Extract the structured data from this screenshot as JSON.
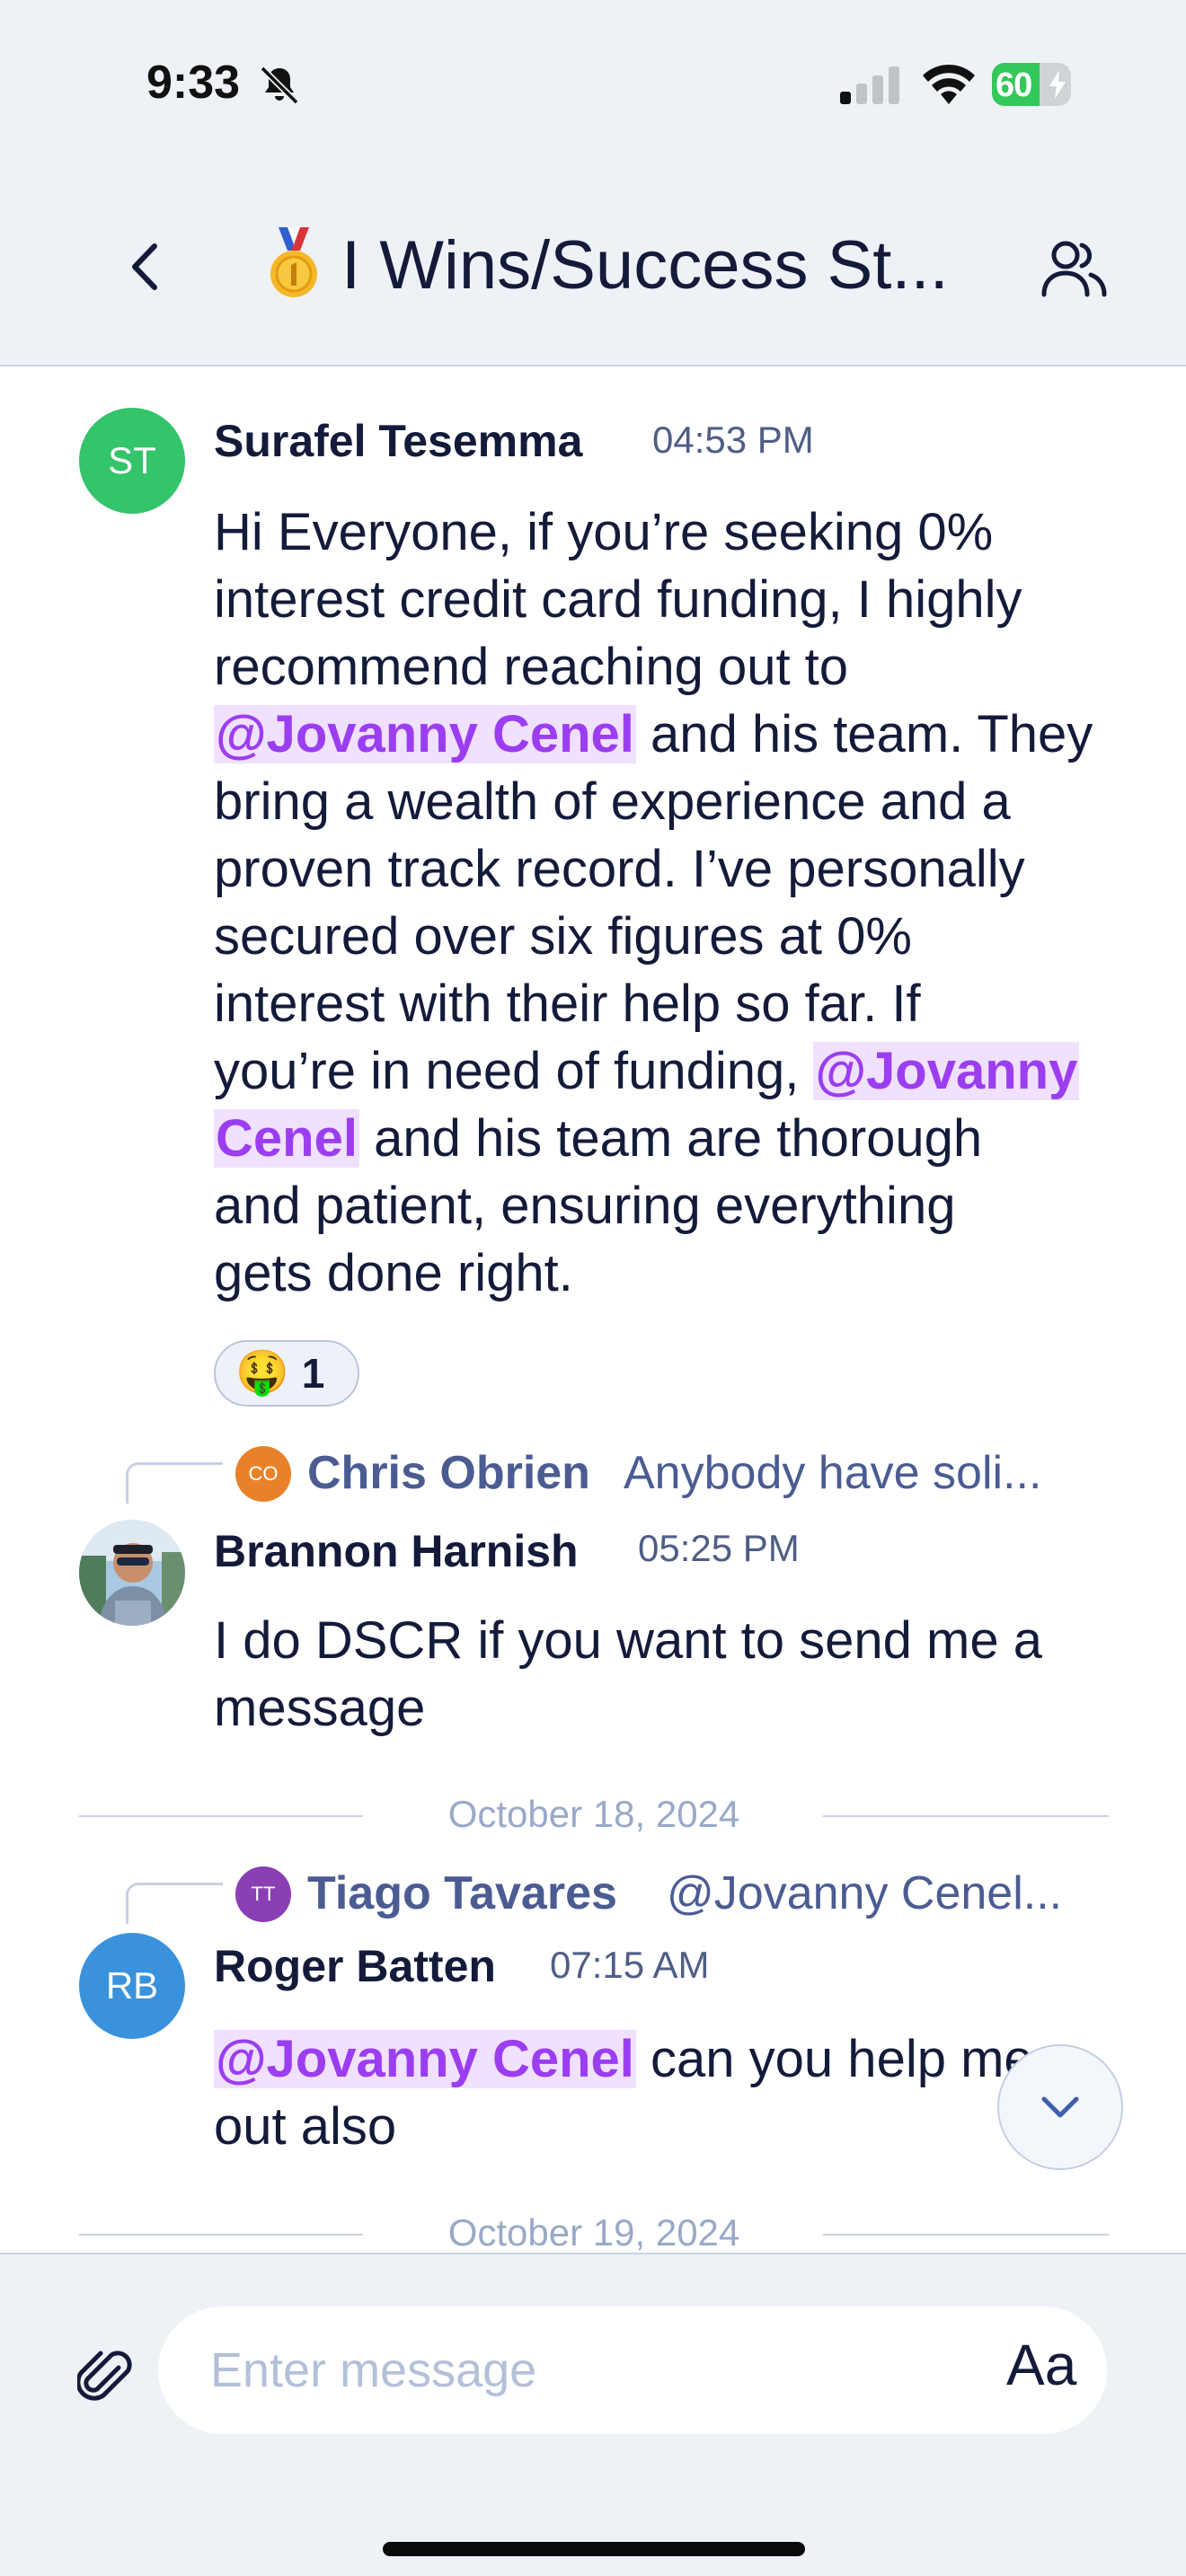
{
  "status_bar": {
    "time": "9:33",
    "battery": "60",
    "battery_level": 0.6,
    "icons": [
      "bell-slash-icon",
      "cellular-signal-icon",
      "wifi-icon",
      "battery-charging-icon"
    ]
  },
  "header": {
    "back_icon": "chevron-left-icon",
    "channel_icon": "medal-icon",
    "title": "I Wins/Success St...",
    "members_icon": "people-icon"
  },
  "messages": [
    {
      "avatar_initials": "ST",
      "avatar_color": "#34c46a",
      "sender": "Surafel Tesemma",
      "time": "04:53 PM",
      "body_lines": [
        [
          {
            "t": "Hi Everyone, if you’re seeking 0%"
          }
        ],
        [
          {
            "t": "interest credit card funding, I highly"
          }
        ],
        [
          {
            "t": "recommend reaching out to"
          }
        ],
        [
          {
            "t": "@Jovanny Cenel",
            "mention": true
          },
          {
            "t": " and his team. They"
          }
        ],
        [
          {
            "t": "bring a wealth of experience and a"
          }
        ],
        [
          {
            "t": "proven track record. I’ve personally"
          }
        ],
        [
          {
            "t": "secured over six figures at 0%"
          }
        ],
        [
          {
            "t": "interest with their help so far. If"
          }
        ],
        [
          {
            "t": "you’re in need of funding, "
          },
          {
            "t": "@Jovanny",
            "mention": true
          }
        ],
        [
          {
            "t": "Cenel",
            "mention": true
          },
          {
            "t": " and his team are thorough"
          }
        ],
        [
          {
            "t": "and patient, ensuring everything"
          }
        ],
        [
          {
            "t": "gets done right."
          }
        ]
      ],
      "reaction": {
        "emoji": "🤑",
        "count": "1"
      }
    },
    {
      "reply_to": {
        "initials": "CO",
        "color": "#e8822a",
        "name": "Chris Obrien",
        "text": "Anybody have soli..."
      },
      "avatar_photo": true,
      "sender": "Brannon Harnish",
      "time": "05:25 PM",
      "body_lines": [
        [
          {
            "t": "I do DSCR if you want to send me a"
          }
        ],
        [
          {
            "t": "message"
          }
        ]
      ]
    },
    {
      "reply_to": {
        "initials": "TT",
        "color": "#8a3fb5",
        "name": "Tiago  Tavares",
        "text": "@Jovanny Cenel..."
      },
      "avatar_initials": "RB",
      "avatar_color": "#3a92dc",
      "sender": "Roger Batten",
      "time": "07:15 AM",
      "body_lines": [
        [
          {
            "t": "@Jovanny Cenel",
            "mention": true
          },
          {
            "t": " can you help me"
          }
        ],
        [
          {
            "t": "out also"
          }
        ]
      ]
    }
  ],
  "date_dividers": [
    "October 18, 2024",
    "October 19, 2024"
  ],
  "composer": {
    "placeholder": "Enter message",
    "format_label": "Aa",
    "attach_icon": "paperclip-icon",
    "scroll_icon": "chevron-down-icon"
  },
  "colors": {
    "mention_text": "#9b3df0",
    "mention_bg": "#efe1ff",
    "header_bg": "#eef2f7",
    "name_text": "#141b3a",
    "reply_text": "#4b5c93"
  }
}
